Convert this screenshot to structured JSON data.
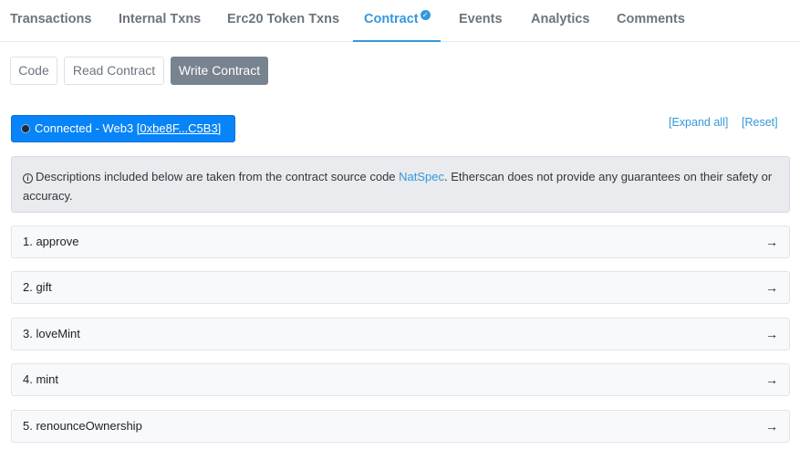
{
  "tabs": [
    {
      "label": "Transactions"
    },
    {
      "label": "Internal Txns"
    },
    {
      "label": "Erc20 Token Txns"
    },
    {
      "label": "Contract"
    },
    {
      "label": "Events"
    },
    {
      "label": "Analytics"
    },
    {
      "label": "Comments"
    }
  ],
  "active_tab": "Contract",
  "subtabs": {
    "code": "Code",
    "read": "Read Contract",
    "write": "Write Contract"
  },
  "connection": {
    "label": "Connected - Web3",
    "address": "[0xbe8F...C5B3]"
  },
  "links": {
    "expand": "[Expand all]",
    "reset": "[Reset]"
  },
  "info": {
    "icon": "info-circle-icon",
    "text_before": "Descriptions included below are taken from the contract source code ",
    "link": "NatSpec",
    "text_after": ". Etherscan does not provide any guarantees on their safety or accuracy."
  },
  "methods": [
    {
      "label": "1. approve"
    },
    {
      "label": "2. gift"
    },
    {
      "label": "3. loveMint"
    },
    {
      "label": "4. mint"
    },
    {
      "label": "5. renounceOwnership"
    }
  ],
  "arrow": "→",
  "colors": {
    "accent": "#3498db",
    "connected": "#0784f7",
    "active_sub": "#77838f"
  }
}
